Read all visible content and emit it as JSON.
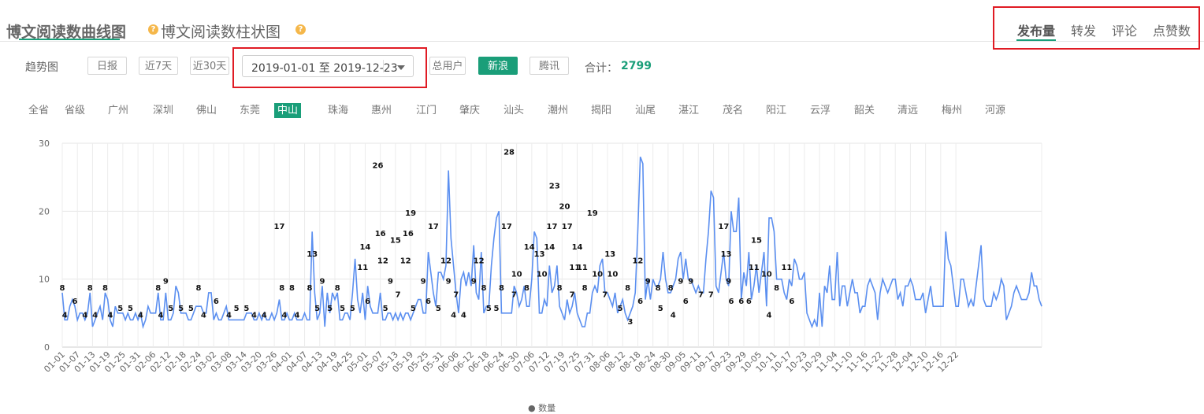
{
  "header": {
    "tabs": [
      {
        "label": "博文阅读数曲线图",
        "active": true
      },
      {
        "label": "博文阅读数柱状图",
        "active": false
      }
    ],
    "help_glyph": "?",
    "metrics": [
      {
        "label": "发布量",
        "active": true
      },
      {
        "label": "转发",
        "active": false
      },
      {
        "label": "评论",
        "active": false
      },
      {
        "label": "点赞数",
        "active": false
      }
    ]
  },
  "toolbar": {
    "trend_label": "趋势图",
    "ranges": [
      "日报",
      "近7天",
      "近30天"
    ],
    "date_range": "2019-01-01 至 2019-12-23",
    "sources": [
      {
        "label": "总用户",
        "active": false
      },
      {
        "label": "新浪",
        "active": true
      },
      {
        "label": "腾讯",
        "active": false
      }
    ],
    "total_label": "合计：",
    "total_value": "2799"
  },
  "regions": [
    {
      "label": "全省",
      "active": false
    },
    {
      "label": "省级",
      "active": false
    },
    {
      "label": "广州",
      "active": false
    },
    {
      "label": "深圳",
      "active": false
    },
    {
      "label": "佛山",
      "active": false
    },
    {
      "label": "东莞",
      "active": false
    },
    {
      "label": "中山",
      "active": true
    },
    {
      "label": "珠海",
      "active": false
    },
    {
      "label": "惠州",
      "active": false
    },
    {
      "label": "江门",
      "active": false
    },
    {
      "label": "肇庆",
      "active": false
    },
    {
      "label": "汕头",
      "active": false
    },
    {
      "label": "潮州",
      "active": false
    },
    {
      "label": "揭阳",
      "active": false
    },
    {
      "label": "汕尾",
      "active": false
    },
    {
      "label": "湛江",
      "active": false
    },
    {
      "label": "茂名",
      "active": false
    },
    {
      "label": "阳江",
      "active": false
    },
    {
      "label": "云浮",
      "active": false
    },
    {
      "label": "韶关",
      "active": false
    },
    {
      "label": "清远",
      "active": false
    },
    {
      "label": "梅州",
      "active": false
    },
    {
      "label": "河源",
      "active": false
    }
  ],
  "colors": {
    "accent": "#1a9e79",
    "line": "#5b8ff0",
    "highlight_box": "#e01b24"
  },
  "chart_data": {
    "type": "line",
    "ylim": [
      0,
      30
    ],
    "yticks": [
      0,
      10,
      20,
      30
    ],
    "grid": true,
    "x_tick_labels": [
      "01-01",
      "01-07",
      "01-13",
      "01-19",
      "01-25",
      "01-31",
      "02-06",
      "02-12",
      "02-18",
      "02-24",
      "03-02",
      "03-08",
      "03-14",
      "03-20",
      "03-26",
      "04-01",
      "04-07",
      "04-13",
      "04-19",
      "04-25",
      "05-01",
      "05-07",
      "05-13",
      "05-19",
      "05-25",
      "05-31",
      "06-06",
      "06-12",
      "06-18",
      "06-24",
      "06-30",
      "07-06",
      "07-12",
      "07-19",
      "07-25",
      "07-31",
      "08-06",
      "08-12",
      "08-18",
      "08-24",
      "08-30",
      "09-05",
      "09-11",
      "09-17",
      "09-23",
      "09-29",
      "10-05",
      "10-11",
      "10-17",
      "10-23",
      "10-29",
      "11-04",
      "11-10",
      "11-16",
      "11-22",
      "11-28",
      "12-04",
      "12-10",
      "12-16",
      "12-22"
    ],
    "legend": "数量",
    "series": [
      {
        "name": "数量",
        "values": [
          8,
          4,
          4,
          6,
          7,
          6,
          4,
          5,
          5,
          4,
          5,
          8,
          3,
          4,
          5,
          6,
          4,
          8,
          7,
          4,
          3,
          6,
          5,
          5,
          5,
          4,
          5,
          4,
          4,
          5,
          4,
          5,
          3,
          4,
          6,
          5,
          5,
          5,
          8,
          4,
          4,
          8,
          4,
          4,
          5,
          9,
          8,
          5,
          5,
          5,
          4,
          4,
          5,
          6,
          6,
          6,
          5,
          5,
          8,
          8,
          4,
          5,
          4,
          4,
          5,
          6,
          4,
          4,
          4,
          4,
          4,
          4,
          4,
          5,
          5,
          5,
          4,
          4,
          5,
          4,
          5,
          4,
          4,
          5,
          4,
          5,
          7,
          4,
          4,
          5,
          4,
          4,
          5,
          4,
          4,
          4,
          5,
          4,
          4,
          17,
          8,
          4,
          5,
          9,
          3,
          8,
          5,
          8,
          7,
          8,
          4,
          4,
          5,
          5,
          4,
          8,
          13,
          7,
          5,
          8,
          4,
          9,
          6,
          5,
          5,
          5,
          8,
          4,
          4,
          5,
          5,
          4,
          5,
          4,
          5,
          4,
          5,
          5,
          4,
          5,
          6,
          7,
          7,
          5,
          5,
          14,
          11,
          8,
          6,
          11,
          11,
          10,
          12,
          26,
          16,
          12,
          8,
          5,
          10,
          11,
          9,
          11,
          9,
          15,
          8,
          7,
          14,
          5,
          6,
          6,
          12,
          16,
          19,
          20,
          5,
          5,
          5,
          5,
          5,
          9,
          8,
          6,
          7,
          9,
          6,
          6,
          10,
          17,
          16,
          5,
          5,
          7,
          6,
          12,
          8,
          9,
          12,
          6,
          5,
          4,
          7,
          5,
          6,
          8,
          5,
          4,
          3,
          3,
          5,
          5,
          8,
          9,
          8,
          12,
          13,
          8,
          8,
          7,
          6,
          8,
          5,
          6,
          7,
          5,
          4,
          5,
          6,
          8,
          17,
          28,
          27,
          7,
          10,
          7,
          10,
          9,
          9,
          10,
          14,
          10,
          8,
          8,
          9,
          10,
          13,
          14,
          10,
          13,
          10,
          10,
          9,
          8,
          9,
          8,
          8,
          13,
          17,
          23,
          22,
          9,
          8,
          11,
          14,
          10,
          9,
          20,
          17,
          17,
          22,
          7,
          11,
          9,
          14,
          7,
          9,
          12,
          8,
          11,
          14,
          6,
          19,
          19,
          17,
          10,
          10,
          10,
          8,
          7,
          10,
          9,
          13,
          12,
          10,
          10,
          11,
          5,
          4,
          3,
          4,
          3,
          8,
          3,
          9,
          8,
          12,
          7,
          7,
          14,
          6,
          9,
          9,
          6,
          8,
          10,
          8,
          8,
          5,
          6,
          6,
          9,
          10,
          9,
          8,
          4,
          8,
          10,
          9,
          8,
          9,
          10,
          10,
          7,
          8,
          6,
          9,
          9,
          10,
          9,
          7,
          7,
          7,
          8,
          5,
          7,
          9,
          6,
          6,
          6,
          6,
          6,
          17,
          13,
          12,
          9,
          6,
          6,
          10,
          10,
          8,
          6,
          7,
          6,
          9,
          12,
          15,
          7,
          6,
          6,
          6,
          8,
          7,
          8,
          10,
          9,
          4,
          5,
          6,
          8,
          9,
          8,
          7,
          7,
          7,
          8,
          11,
          9,
          9,
          7,
          6
        ]
      }
    ],
    "annotations": [
      {
        "label": "8",
        "x": 0
      },
      {
        "label": "4",
        "x": 1
      },
      {
        "label": "6",
        "x": 5
      },
      {
        "label": "4",
        "x": 9
      },
      {
        "label": "8",
        "x": 11
      },
      {
        "label": "4",
        "x": 13
      },
      {
        "label": "8",
        "x": 17
      },
      {
        "label": "4",
        "x": 19
      },
      {
        "label": "5",
        "x": 23
      },
      {
        "label": "5",
        "x": 27
      },
      {
        "label": "4",
        "x": 31
      },
      {
        "label": "8",
        "x": 38
      },
      {
        "label": "4",
        "x": 39
      },
      {
        "label": "9",
        "x": 41
      },
      {
        "label": "5",
        "x": 43
      },
      {
        "label": "5",
        "x": 47
      },
      {
        "label": "5",
        "x": 51
      },
      {
        "label": "8",
        "x": 54
      },
      {
        "label": "4",
        "x": 56
      },
      {
        "label": "6",
        "x": 61
      },
      {
        "label": "4",
        "x": 66
      },
      {
        "label": "5",
        "x": 69
      },
      {
        "label": "5",
        "x": 73
      },
      {
        "label": "4",
        "x": 76
      },
      {
        "label": "4",
        "x": 80
      },
      {
        "label": "17",
        "x": 86
      },
      {
        "label": "8",
        "x": 87
      },
      {
        "label": "4",
        "x": 88
      },
      {
        "label": "8",
        "x": 91
      },
      {
        "label": "4",
        "x": 93
      },
      {
        "label": "8",
        "x": 98
      },
      {
        "label": "13",
        "x": 99
      },
      {
        "label": "5",
        "x": 101
      },
      {
        "label": "9",
        "x": 103
      },
      {
        "label": "5",
        "x": 106
      },
      {
        "label": "8",
        "x": 109
      },
      {
        "label": "5",
        "x": 111
      },
      {
        "label": "5",
        "x": 115
      },
      {
        "label": "11",
        "x": 119
      },
      {
        "label": "14",
        "x": 120
      },
      {
        "label": "6",
        "x": 121
      },
      {
        "label": "26",
        "x": 125
      },
      {
        "label": "16",
        "x": 126
      },
      {
        "label": "12",
        "x": 127
      },
      {
        "label": "5",
        "x": 128
      },
      {
        "label": "9",
        "x": 130
      },
      {
        "label": "15",
        "x": 132
      },
      {
        "label": "7",
        "x": 133
      },
      {
        "label": "12",
        "x": 136
      },
      {
        "label": "16",
        "x": 137
      },
      {
        "label": "19",
        "x": 138
      },
      {
        "label": "5",
        "x": 139
      },
      {
        "label": "9",
        "x": 143
      },
      {
        "label": "6",
        "x": 145
      },
      {
        "label": "17",
        "x": 147
      },
      {
        "label": "5",
        "x": 149
      },
      {
        "label": "12",
        "x": 152
      },
      {
        "label": "9",
        "x": 153
      },
      {
        "label": "4",
        "x": 155
      },
      {
        "label": "7",
        "x": 156
      },
      {
        "label": "4",
        "x": 159
      },
      {
        "label": "9",
        "x": 163
      },
      {
        "label": "12",
        "x": 165
      },
      {
        "label": "8",
        "x": 167
      },
      {
        "label": "5",
        "x": 169
      },
      {
        "label": "5",
        "x": 172
      },
      {
        "label": "8",
        "x": 174
      },
      {
        "label": "17",
        "x": 176
      },
      {
        "label": "28",
        "x": 177
      },
      {
        "label": "7",
        "x": 179
      },
      {
        "label": "10",
        "x": 180
      },
      {
        "label": "8",
        "x": 184
      },
      {
        "label": "14",
        "x": 185
      },
      {
        "label": "13",
        "x": 189
      },
      {
        "label": "10",
        "x": 190
      },
      {
        "label": "14",
        "x": 193
      },
      {
        "label": "17",
        "x": 194
      },
      {
        "label": "23",
        "x": 195
      },
      {
        "label": "8",
        "x": 197
      },
      {
        "label": "20",
        "x": 199
      },
      {
        "label": "17",
        "x": 200
      },
      {
        "label": "7",
        "x": 202
      },
      {
        "label": "11",
        "x": 203
      },
      {
        "label": "14",
        "x": 204
      },
      {
        "label": "11",
        "x": 206
      },
      {
        "label": "8",
        "x": 207
      },
      {
        "label": "19",
        "x": 210
      },
      {
        "label": "10",
        "x": 212
      },
      {
        "label": "7",
        "x": 215
      },
      {
        "label": "13",
        "x": 217
      },
      {
        "label": "10",
        "x": 218
      },
      {
        "label": "5",
        "x": 221
      },
      {
        "label": "3",
        "x": 225
      },
      {
        "label": "8",
        "x": 224
      },
      {
        "label": "12",
        "x": 228
      },
      {
        "label": "6",
        "x": 229
      },
      {
        "label": "9",
        "x": 232
      },
      {
        "label": "8",
        "x": 236
      },
      {
        "label": "5",
        "x": 237
      },
      {
        "label": "8",
        "x": 241
      },
      {
        "label": "4",
        "x": 242
      },
      {
        "label": "9",
        "x": 245
      },
      {
        "label": "6",
        "x": 247
      },
      {
        "label": "9",
        "x": 249
      },
      {
        "label": "7",
        "x": 253
      },
      {
        "label": "7",
        "x": 257
      },
      {
        "label": "17",
        "x": 262
      },
      {
        "label": "13",
        "x": 263
      },
      {
        "label": "9",
        "x": 264
      },
      {
        "label": "6",
        "x": 265
      },
      {
        "label": "6",
        "x": 269
      },
      {
        "label": "6",
        "x": 272
      },
      {
        "label": "11",
        "x": 274
      },
      {
        "label": "15",
        "x": 275
      },
      {
        "label": "10",
        "x": 279
      },
      {
        "label": "4",
        "x": 280
      },
      {
        "label": "8",
        "x": 283
      },
      {
        "label": "11",
        "x": 287
      },
      {
        "label": "6",
        "x": 289
      }
    ]
  }
}
